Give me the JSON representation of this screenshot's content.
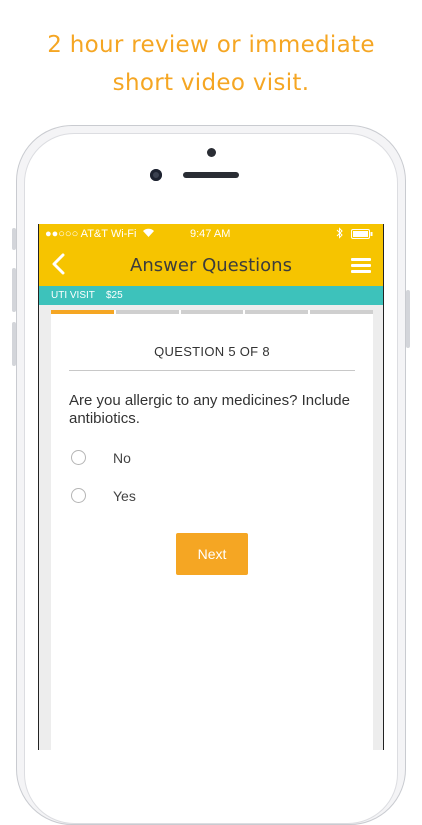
{
  "headline": {
    "line1": "2 hour review or immediate",
    "line2": "short video visit."
  },
  "status_bar": {
    "carrier": "●●○○○ AT&T Wi-Fi",
    "time": "9:47 AM"
  },
  "nav": {
    "title": "Answer Questions",
    "back_icon": "chevron-left-icon",
    "menu_icon": "hamburger-menu-icon"
  },
  "visit": {
    "name": "UTI VISIT",
    "price": "$25"
  },
  "progress": {
    "segments": 5,
    "completed": 1
  },
  "question": {
    "counter": "QUESTION 5 OF 8",
    "text": "Are you allergic to any medicines? Include antibiotics.",
    "options": [
      {
        "label": "No"
      },
      {
        "label": "Yes"
      }
    ]
  },
  "actions": {
    "next_label": "Next"
  },
  "colors": {
    "accent": "#f5a623",
    "header": "#f6c400",
    "teal": "#3dc2bb"
  }
}
